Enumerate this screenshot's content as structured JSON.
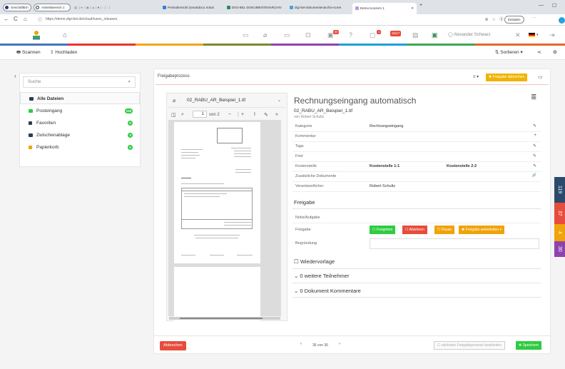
{
  "browser": {
    "pinned": [
      "Geschäftlich",
      "Arbeitsbereich 1"
    ],
    "tabs": [
      {
        "label": "Preisübersicht (smartdocu Soluti",
        "color": "#3b7dd8"
      },
      {
        "label": "DIGI-BEL-DOKUMENTENARCHIV",
        "color": "#2e8b57"
      },
      {
        "label": "digi-bel-dokumentenarchiv-scree",
        "color": "#4aa3df"
      },
      {
        "label": "Demo Konzern 1",
        "color": "#b39ddb"
      }
    ],
    "new_tab": "+",
    "url": "https://demo.digi-bel.de/cloud#uses_releases",
    "sign_in": "Einladen",
    "minimize": "—",
    "maximize": "☐",
    "more": "···"
  },
  "app": {
    "user": "Alexander Schwarz",
    "badges": [
      "99",
      "1",
      "15/17"
    ],
    "colors": {
      "accent": "#f0b400",
      "green": "#2ecc40",
      "red": "#e74c3c",
      "orange": "#f0a30a"
    }
  },
  "toolbar": {
    "scan": "Scannen",
    "upload": "Hochladen",
    "sort": "Sortieren"
  },
  "sidebar": {
    "search_placeholder": "Suche",
    "items": [
      {
        "label": "Alle Dateien",
        "count": "",
        "icon": "folder-icon",
        "icon_color": "#2c3e50"
      },
      {
        "label": "Posteingang",
        "count": "119",
        "icon": "inbox-icon",
        "icon_color": "#2ecc40"
      },
      {
        "label": "Favoriten",
        "count": "0",
        "icon": "bookmark-icon",
        "icon_color": "#2c3e50"
      },
      {
        "label": "Zwischenablage",
        "count": "3",
        "icon": "clipboard-icon",
        "icon_color": "#2c3e50"
      },
      {
        "label": "Papierkorb",
        "count": "0",
        "icon": "trash-icon",
        "icon_color": "#f0a30a"
      }
    ]
  },
  "main": {
    "title": "Freigabeprozess",
    "stop_button": "Freigabe abbrechen",
    "doc": {
      "filename": "02_RABU_AR_Beispiel_1.tif",
      "page": "1",
      "of": "von 2"
    },
    "panel_title": "Rechnungseingang automatisch",
    "subtitle": "02_RABU_AR_Beispiel_1.tif",
    "author": "von Robert Schultz",
    "fields": [
      {
        "key": "Kategorie",
        "value": "Rechnungseingang",
        "value2": "",
        "action": "✎"
      },
      {
        "key": "Kommentar",
        "value": "",
        "value2": "",
        "action": "+"
      },
      {
        "key": "Tags",
        "value": "",
        "value2": "",
        "action": "✎"
      },
      {
        "key": "Frist",
        "value": "",
        "value2": "",
        "action": "✎"
      },
      {
        "key": "Kostenstelle",
        "value": "Kostenstelle 1:1",
        "value2": "Kostenstelle 2:2",
        "action": "✎"
      },
      {
        "key": "Zusätzliche Dokumente",
        "value": "",
        "value2": "",
        "action": "🔗"
      },
      {
        "key": "Verantwortlicher",
        "value": "Robert Schultz",
        "value2": "",
        "action": ""
      }
    ],
    "section": "Freigabe",
    "note_label": "Notiz/Aufgabe",
    "approval_label": "Freigabe",
    "approval_buttons": [
      {
        "label": "Freigeben",
        "color": "#2ecc40"
      },
      {
        "label": "Ablehnen",
        "color": "#e74c3c"
      },
      {
        "label": "Pause",
        "color": "#f0a30a"
      },
      {
        "label": "Freigabe weiterleiten",
        "color": "#f0a30a"
      }
    ],
    "reason_label": "Begründung",
    "resubmit": "Wiedervorlage",
    "participants": "0 weitere Teilnehmer",
    "comments": "0 Dokument Kommentare"
  },
  "footer": {
    "cancel": "Abbrechen",
    "pager": "36 von 36",
    "next": "nächsten Freigabeprozess bearbeiten",
    "save": "Speichern"
  },
  "edge_tabs": [
    {
      "label": "119",
      "color": "#2c4a6b"
    },
    {
      "label": "37",
      "color": "#e74c3c"
    },
    {
      "label": "4",
      "color": "#f0a30a"
    },
    {
      "label": "30",
      "color": "#8e44ad"
    }
  ]
}
